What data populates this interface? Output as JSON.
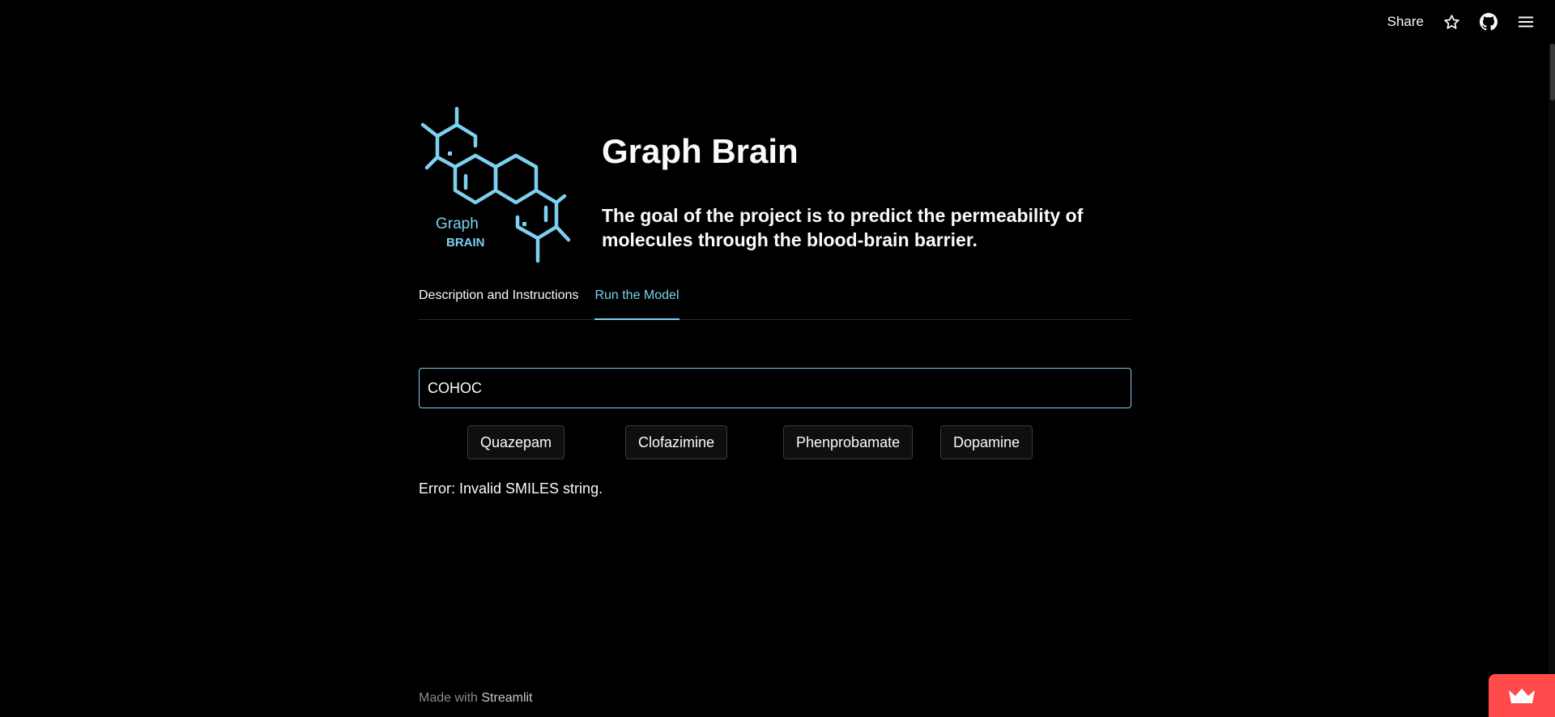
{
  "toolbar": {
    "share_label": "Share",
    "icons": [
      "star-icon",
      "github-icon",
      "menu-icon"
    ]
  },
  "header": {
    "logo_text_top": "Graph",
    "logo_text_bottom": "BRAIN",
    "title": "Graph Brain",
    "subtitle": "The goal of the project is to predict the permeability of molecules through the blood-brain barrier."
  },
  "tabs": [
    {
      "label": "Description and Instructions",
      "active": false
    },
    {
      "label": "Run the Model",
      "active": true
    }
  ],
  "input": {
    "value": "COHOC"
  },
  "molecule_buttons": [
    {
      "label": "Quazepam"
    },
    {
      "label": "Clofazimine"
    },
    {
      "label": "Phenprobamate"
    },
    {
      "label": "Dopamine"
    }
  ],
  "error": "Error: Invalid SMILES string.",
  "footer": {
    "prefix": "Made with",
    "brand": "Streamlit"
  },
  "colors": {
    "background": "#000000",
    "accent": "#7dd0ef",
    "badge": "#ff4b4b"
  }
}
